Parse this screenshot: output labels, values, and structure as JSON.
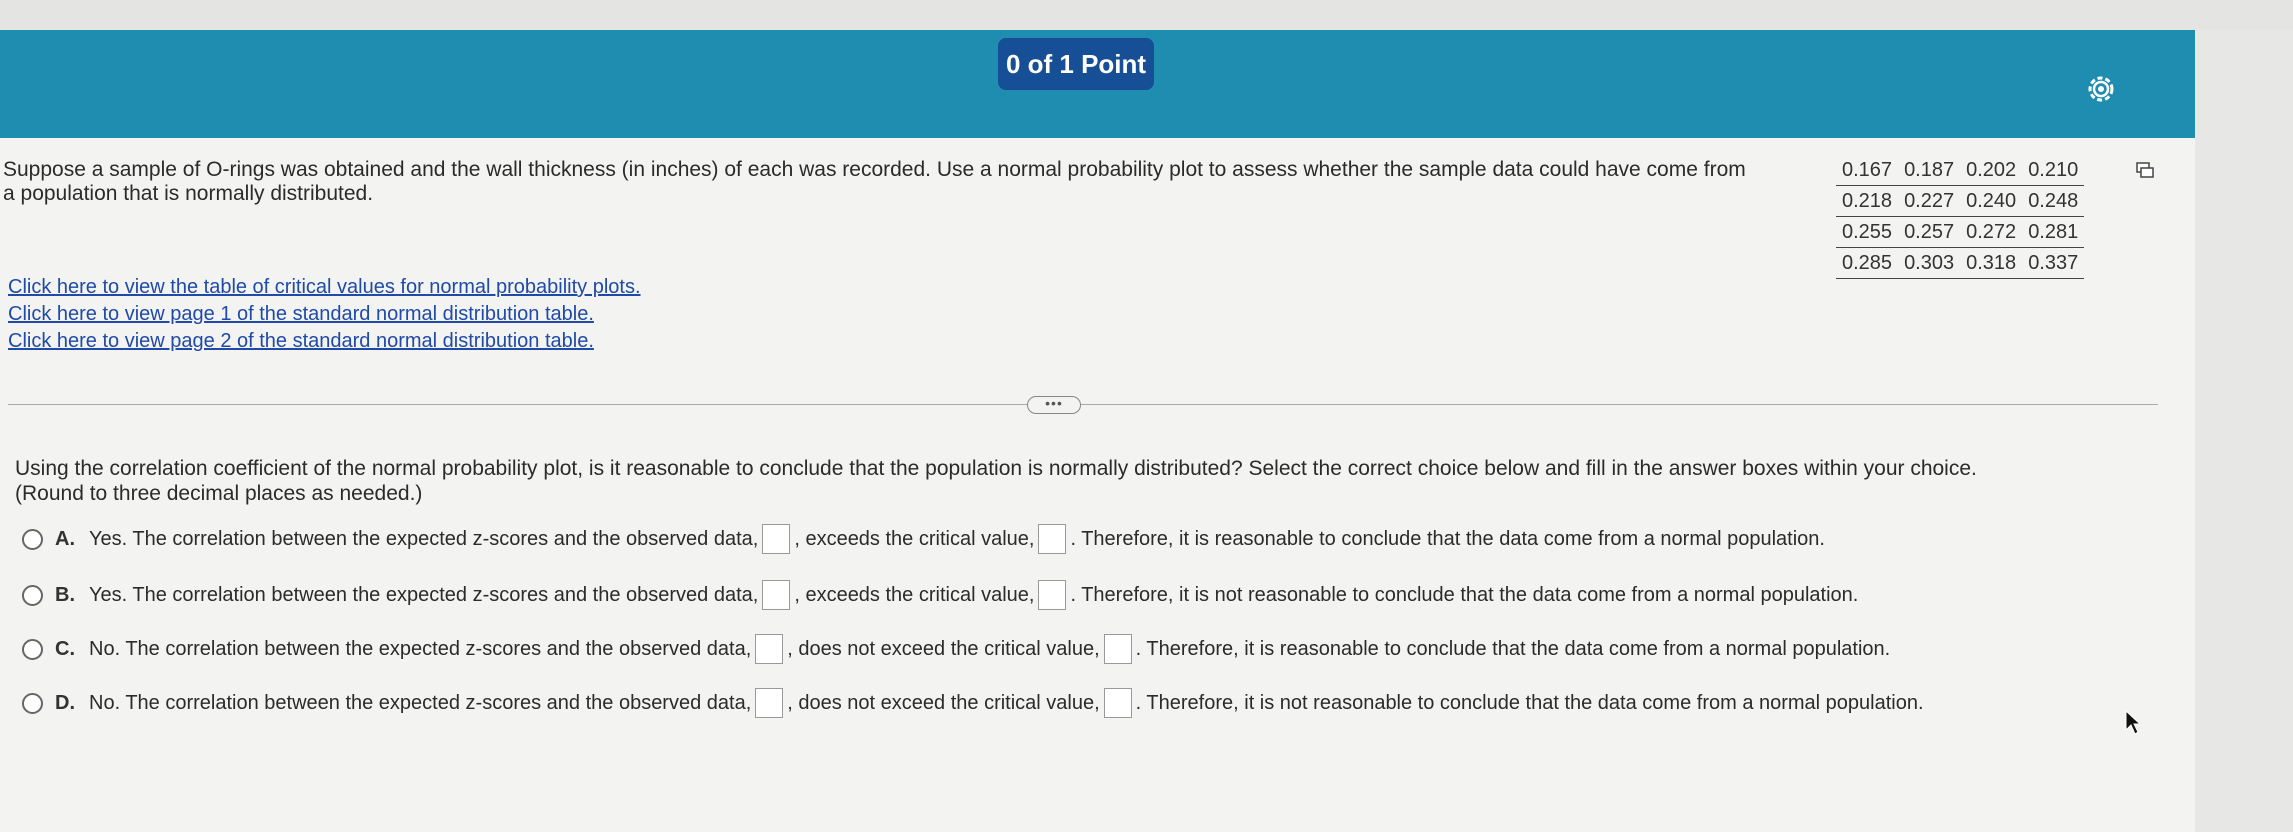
{
  "header": {
    "points_label": "0 of 1 Point"
  },
  "question": {
    "text": "Suppose a sample of O-rings was obtained and the wall thickness (in inches) of each was recorded. Use a normal probability plot to assess whether the sample data could have come from a population that is normally distributed."
  },
  "data_table": {
    "rows": [
      [
        "0.167",
        "0.187",
        "0.202",
        "0.210"
      ],
      [
        "0.218",
        "0.227",
        "0.240",
        "0.248"
      ],
      [
        "0.255",
        "0.257",
        "0.272",
        "0.281"
      ],
      [
        "0.285",
        "0.303",
        "0.318",
        "0.337"
      ]
    ]
  },
  "links": {
    "critical_values": "Click here to view the table of critical values for normal probability plots.",
    "page1": "Click here to view page 1 of the standard normal distribution table.",
    "page2": "Click here to view page 2 of the standard normal distribution table."
  },
  "more_label": "•••",
  "prompt": {
    "line1": "Using the correlation coefficient of the normal probability plot, is it reasonable to conclude that the population is normally distributed? Select the correct choice below and fill in the answer boxes within your choice.",
    "line2": "(Round to three decimal places as needed.)"
  },
  "choices": [
    {
      "letter": "A.",
      "part1": "Yes. The correlation between the expected z-scores and the observed data,",
      "part2": ", exceeds the critical value,",
      "part3": ". Therefore, it is reasonable to conclude that the data come from a normal population."
    },
    {
      "letter": "B.",
      "part1": "Yes. The correlation between the expected z-scores and the observed data,",
      "part2": ", exceeds the critical value,",
      "part3": ". Therefore, it is not reasonable to conclude that the data come from a normal population."
    },
    {
      "letter": "C.",
      "part1": "No. The correlation between the expected z-scores and the observed data,",
      "part2": ", does not exceed the critical value,",
      "part3": ". Therefore, it is reasonable to conclude that the data come from a normal population."
    },
    {
      "letter": "D.",
      "part1": "No. The correlation between the expected z-scores and the observed data,",
      "part2": ", does not exceed the critical value,",
      "part3": ". Therefore, it is not reasonable to conclude that the data come from a normal population."
    }
  ],
  "colors": {
    "header_bar": "#1e8db0",
    "points_badge": "#164f96",
    "link": "#1f4aa8"
  },
  "icons": [
    "gear-icon",
    "copy-data-icon",
    "mouse-cursor-icon"
  ]
}
